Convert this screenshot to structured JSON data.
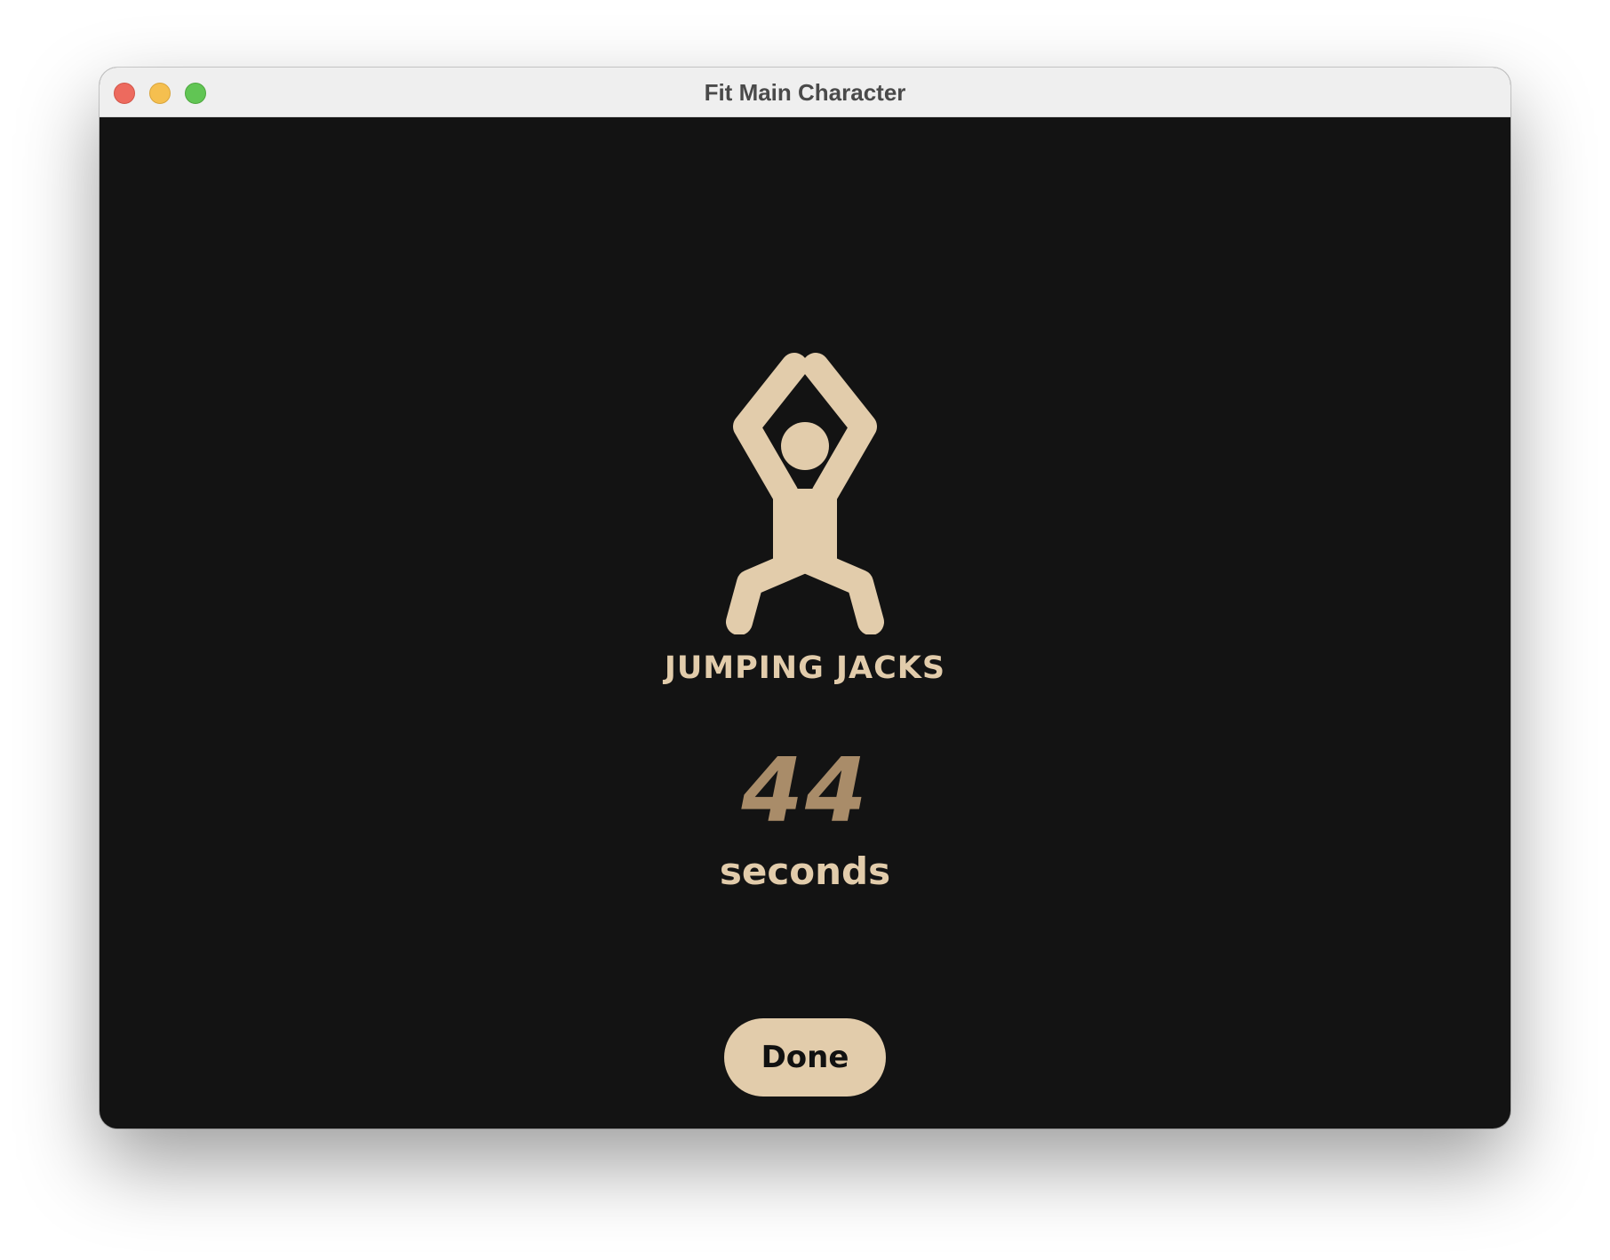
{
  "window": {
    "title": "Fit Main Character"
  },
  "workout": {
    "icon": "jumping-jacks-figure-icon",
    "exercise_name": "JUMPING JACKS",
    "timer_value": "44",
    "timer_unit": "seconds"
  },
  "actions": {
    "done_label": "Done"
  },
  "colors": {
    "background": "#131313",
    "accent": "#e2ccab",
    "timer": "#a98c69"
  }
}
